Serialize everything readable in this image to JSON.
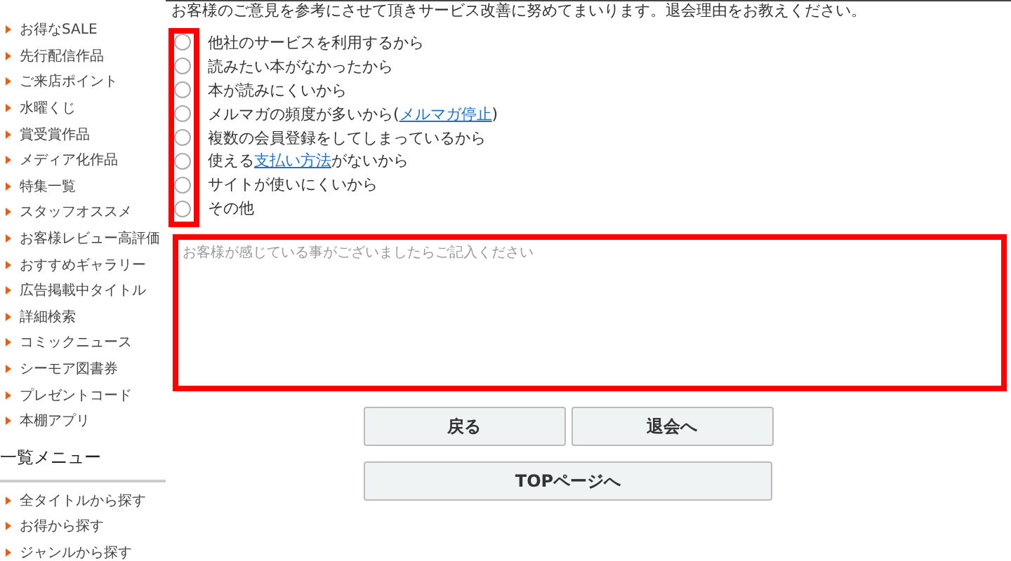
{
  "sidebar": {
    "items": [
      {
        "label": "お得なSALE"
      },
      {
        "label": "先行配信作品"
      },
      {
        "label": "ご来店ポイント"
      },
      {
        "label": "水曜くじ"
      },
      {
        "label": "賞受賞作品"
      },
      {
        "label": "メディア化作品"
      },
      {
        "label": "特集一覧"
      },
      {
        "label": "スタッフオススメ"
      },
      {
        "label": "お客様レビュー高評価"
      },
      {
        "label": "おすすめギャラリー"
      },
      {
        "label": "広告掲載中タイトル"
      },
      {
        "label": "詳細検索"
      },
      {
        "label": "コミックニュース"
      },
      {
        "label": "シーモア図書券"
      },
      {
        "label": "プレゼントコード"
      },
      {
        "label": "本棚アプリ"
      }
    ],
    "section_title": "一覧メニュー",
    "section_items": [
      {
        "label": "全タイトルから探す"
      },
      {
        "label": "お得から探す"
      },
      {
        "label": "ジャンルから探す"
      }
    ]
  },
  "intro": "お客様のご意見を参考にさせて頂きサービス改善に努めてまいります。退会理由をお教えください。",
  "reasons": [
    {
      "selected": false,
      "parts": [
        {
          "kind": "text",
          "text": "他社のサービスを利用するから"
        }
      ]
    },
    {
      "selected": false,
      "parts": [
        {
          "kind": "text",
          "text": "読みたい本がなかったから"
        }
      ]
    },
    {
      "selected": false,
      "parts": [
        {
          "kind": "text",
          "text": "本が読みにくいから"
        }
      ]
    },
    {
      "selected": false,
      "parts": [
        {
          "kind": "text",
          "text": "メルマガの頻度が多いから("
        },
        {
          "kind": "link",
          "text": "メルマガ停止"
        },
        {
          "kind": "text",
          "text": ")"
        }
      ]
    },
    {
      "selected": false,
      "parts": [
        {
          "kind": "text",
          "text": "複数の会員登録をしてしまっているから"
        }
      ]
    },
    {
      "selected": false,
      "parts": [
        {
          "kind": "text",
          "text": "使える"
        },
        {
          "kind": "link",
          "text": "支払い方法"
        },
        {
          "kind": "text",
          "text": "がないから"
        }
      ]
    },
    {
      "selected": false,
      "parts": [
        {
          "kind": "text",
          "text": "サイトが使いにくいから"
        }
      ]
    },
    {
      "selected": false,
      "parts": [
        {
          "kind": "text",
          "text": "その他"
        }
      ]
    }
  ],
  "comment": {
    "placeholder": "お客様が感じている事がございましたらご記入ください"
  },
  "buttons": [
    {
      "label": "戻る"
    },
    {
      "label": "退会へ"
    }
  ],
  "top_button": {
    "label": "TOPページへ"
  }
}
